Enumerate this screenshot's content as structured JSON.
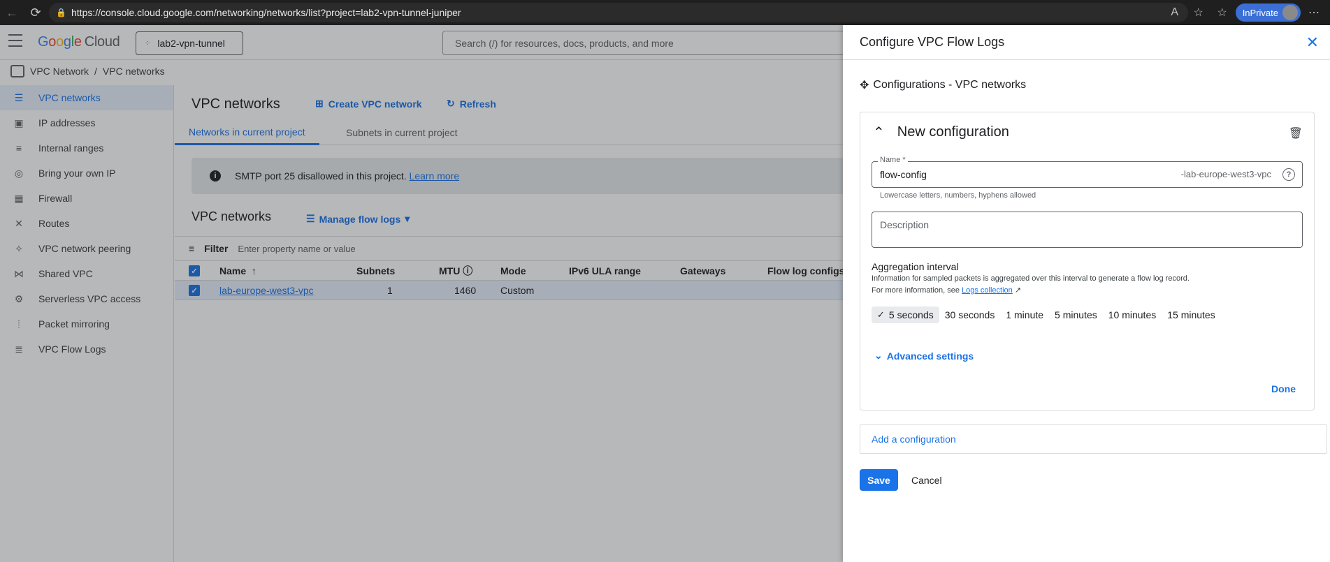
{
  "browser": {
    "url": "https://console.cloud.google.com/networking/networks/list?project=lab2-vpn-tunnel-juniper",
    "inprivate_label": "InPrivate"
  },
  "header": {
    "logo_g": "G",
    "logo_o1": "o",
    "logo_o2": "o",
    "logo_g2": "g",
    "logo_l": "l",
    "logo_e": "e",
    "logo_cloud": "Cloud",
    "project": "lab2-vpn-tunnel",
    "search_placeholder": "Search (/) for resources, docs, products, and more"
  },
  "breadcrumb": {
    "root": "VPC Network",
    "sep": "/",
    "current": "VPC networks"
  },
  "sidebar": {
    "items": [
      {
        "label": "VPC networks"
      },
      {
        "label": "IP addresses"
      },
      {
        "label": "Internal ranges"
      },
      {
        "label": "Bring your own IP"
      },
      {
        "label": "Firewall"
      },
      {
        "label": "Routes"
      },
      {
        "label": "VPC network peering"
      },
      {
        "label": "Shared VPC"
      },
      {
        "label": "Serverless VPC access"
      },
      {
        "label": "Packet mirroring"
      },
      {
        "label": "VPC Flow Logs"
      }
    ]
  },
  "main": {
    "title": "VPC networks",
    "create_label": "Create VPC network",
    "refresh_label": "Refresh",
    "tabs": [
      {
        "label": "Networks in current project"
      },
      {
        "label": "Subnets in current project"
      }
    ],
    "banner_text": "SMTP port 25 disallowed in this project.",
    "banner_link": "Learn more",
    "section_title": "VPC networks",
    "manage_label": "Manage flow logs",
    "filter_label": "Filter",
    "filter_placeholder": "Enter property name or value",
    "columns": {
      "name": "Name",
      "subnets": "Subnets",
      "mtu": "MTU",
      "mode": "Mode",
      "ipv6": "IPv6 ULA range",
      "gateways": "Gateways",
      "flowlogs": "Flow log configs"
    },
    "rows": [
      {
        "name": "lab-europe-west3-vpc",
        "subnets": "1",
        "mtu": "1460",
        "mode": "Custom"
      }
    ]
  },
  "panel": {
    "title": "Configure VPC Flow Logs",
    "config_title": "Configurations - VPC networks",
    "card_title": "New configuration",
    "name_label": "Name *",
    "name_value": "flow-config",
    "name_suffix": "-lab-europe-west3-vpc",
    "name_hint": "Lowercase letters, numbers, hyphens allowed",
    "description_placeholder": "Description",
    "agg_title": "Aggregation interval",
    "agg_info": "Information for sampled packets is aggregated over this interval to generate a flow log record.",
    "agg_more": "For more information, see",
    "agg_link": "Logs collection",
    "intervals": [
      "5 seconds",
      "30 seconds",
      "1 minute",
      "5 minutes",
      "10 minutes",
      "15 minutes"
    ],
    "selected_interval": "5 seconds",
    "advanced_label": "Advanced settings",
    "done_label": "Done",
    "add_config_label": "Add a configuration",
    "save_label": "Save",
    "cancel_label": "Cancel"
  },
  "colors": {
    "accent": "#1a73e8",
    "overlay": "rgba(32,33,36,0.32)"
  }
}
